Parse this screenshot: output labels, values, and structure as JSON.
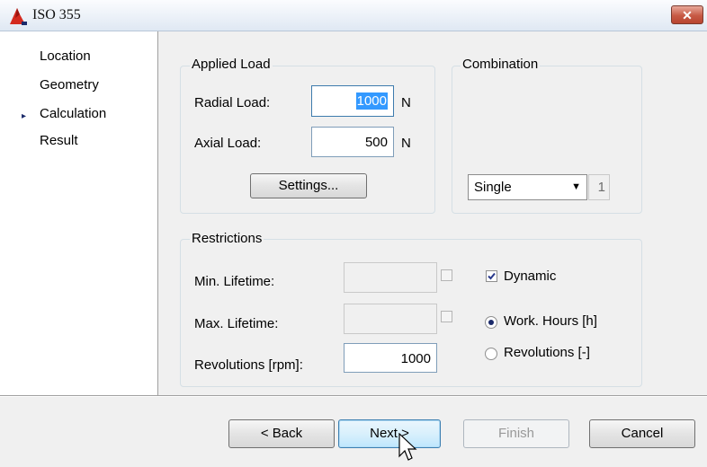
{
  "window": {
    "title": "ISO 355",
    "close_label": "✕"
  },
  "sidebar": {
    "items": [
      {
        "label": "Location"
      },
      {
        "label": "Geometry"
      },
      {
        "label": "Calculation",
        "active": true
      },
      {
        "label": "Result"
      }
    ],
    "active_marker": "▸"
  },
  "applied_load": {
    "title": "Applied Load",
    "radial_label": "Radial Load:",
    "radial_value": "1000",
    "radial_unit": "N",
    "axial_label": "Axial Load:",
    "axial_value": "500",
    "axial_unit": "N",
    "settings_label": "Settings..."
  },
  "combination": {
    "title": "Combination",
    "select_value": "Single",
    "count_value": "1"
  },
  "restrictions": {
    "title": "Restrictions",
    "min_lifetime_label": "Min. Lifetime:",
    "min_lifetime_value": "",
    "max_lifetime_label": "Max. Lifetime:",
    "max_lifetime_value": "",
    "revolutions_label": "Revolutions [rpm]:",
    "revolutions_value": "1000",
    "dynamic_label": "Dynamic",
    "dynamic_checked": true,
    "work_hours_label": "Work. Hours [h]",
    "revolutions_option_label": "Revolutions [-]",
    "selected_option": "Work. Hours [h]"
  },
  "footer": {
    "back_label": "< Back",
    "next_label": "Next >",
    "finish_label": "Finish",
    "cancel_label": "Cancel"
  }
}
